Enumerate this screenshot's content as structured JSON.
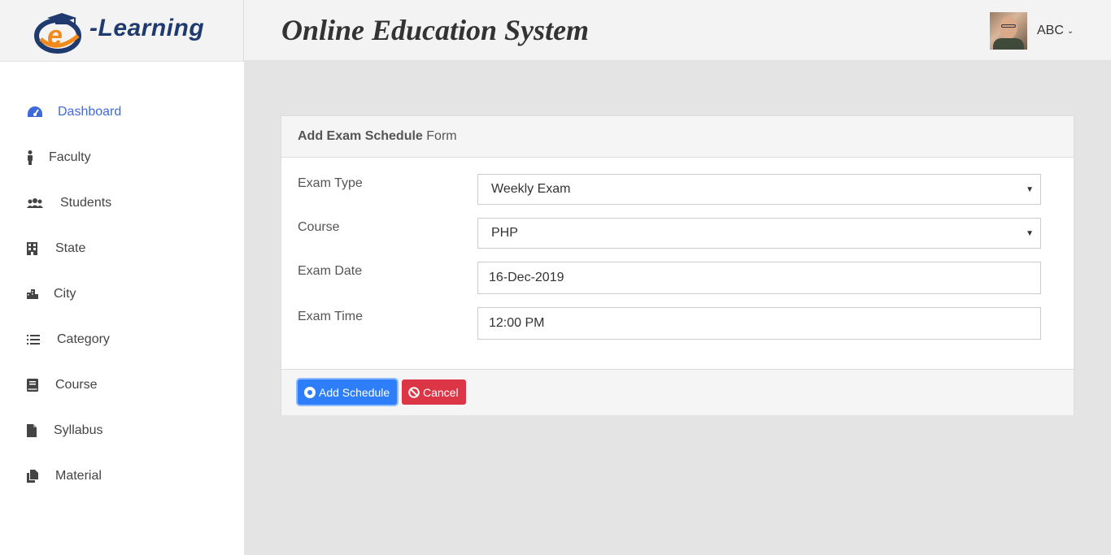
{
  "header": {
    "logo_text": "-Learning",
    "site_title": "Online Education System",
    "user": {
      "name": "ABC"
    }
  },
  "sidebar": {
    "items": [
      {
        "label": "Dashboard",
        "icon": "dashboard-icon",
        "active": true
      },
      {
        "label": "Faculty",
        "icon": "person-icon"
      },
      {
        "label": "Students",
        "icon": "users-icon"
      },
      {
        "label": "State",
        "icon": "building-icon"
      },
      {
        "label": "City",
        "icon": "city-icon"
      },
      {
        "label": "Category",
        "icon": "list-icon"
      },
      {
        "label": "Course",
        "icon": "book-icon"
      },
      {
        "label": "Syllabus",
        "icon": "file-icon"
      },
      {
        "label": "Material",
        "icon": "files-icon"
      }
    ]
  },
  "form": {
    "title_bold": "Add Exam Schedule",
    "title_rest": "Form",
    "fields": {
      "exam_type": {
        "label": "Exam Type",
        "value": "Weekly Exam"
      },
      "course": {
        "label": "Course",
        "value": "PHP"
      },
      "exam_date": {
        "label": "Exam Date",
        "value": "16-Dec-2019"
      },
      "exam_time": {
        "label": "Exam Time",
        "value": "12:00 PM"
      }
    },
    "buttons": {
      "add_label": "Add Schedule",
      "cancel_label": "Cancel"
    }
  },
  "colors": {
    "accent": "#3f6ad8",
    "primary_button": "#2d7ef8",
    "danger_button": "#dc3545",
    "logo_orange": "#f08a1c",
    "logo_navy": "#1f3a6e"
  }
}
